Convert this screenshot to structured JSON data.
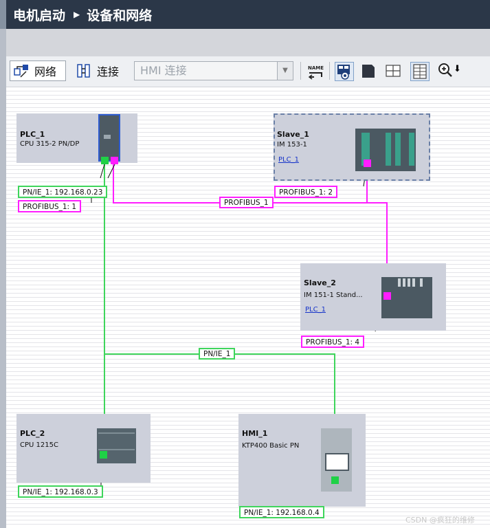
{
  "title": {
    "project": "电机启动",
    "separator": "▶",
    "section": "设备和网络"
  },
  "toolbar": {
    "network_label": "网络",
    "connect_label": "连接",
    "connection_combo_value": "HMI 连接",
    "combo_arrow": "▼",
    "name_icon_text": "NAME",
    "zoom_arrow": "⬇"
  },
  "devices": {
    "plc1": {
      "name": "PLC_1",
      "type": "CPU 315-2 PN/DP",
      "pn_label": "PN/IE_1:  192.168.0.23",
      "profibus_label": "PROFIBUS_1:  1"
    },
    "slave1": {
      "name": "Slave_1",
      "type": "IM 153-1",
      "link": "PLC_1",
      "profibus_label": "PROFIBUS_1:  2"
    },
    "slave2": {
      "name": "Slave_2",
      "type": "IM 151-1 Stand...",
      "link": "PLC_1",
      "profibus_label": "PROFIBUS_1:  4"
    },
    "plc2": {
      "name": "PLC_2",
      "type": "CPU 1215C",
      "pn_label": "PN/IE_1:  192.168.0.3"
    },
    "hmi1": {
      "name": "HMI_1",
      "type": "KTP400 Basic PN",
      "pn_label": "PN/IE_1:  192.168.0.4"
    }
  },
  "networks": {
    "profibus": {
      "label": "PROFIBUS_1",
      "color": "#ff1dff"
    },
    "pnie": {
      "label": "PN/IE_1",
      "color": "#3ed55b"
    }
  },
  "watermark": "CSDN @疯狂的维修"
}
